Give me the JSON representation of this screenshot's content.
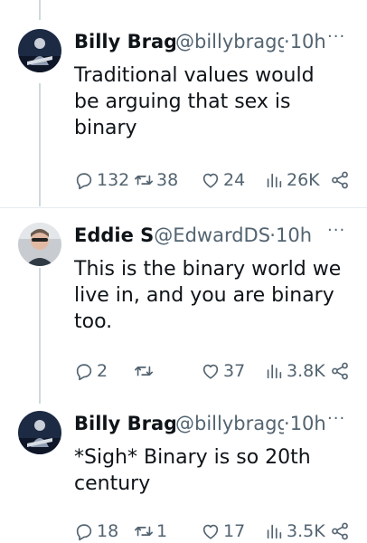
{
  "tweets": [
    {
      "name": "Billy Brag",
      "handle": "@billybragg",
      "dot": "·",
      "time": "10h",
      "text": "Traditional values would be arguing that sex is binary",
      "replies": "132",
      "retweets": "38",
      "likes": "24",
      "views": "26K"
    },
    {
      "name": "Eddie S",
      "handle": "@EdwardDS",
      "dot": "·",
      "time": "10h",
      "text": "This is the binary world we live in, and you are binary too.",
      "replies": "2",
      "retweets": "",
      "likes": "37",
      "views": "3.8K"
    },
    {
      "name": "Billy Brag",
      "handle": "@billybragg",
      "dot": "·",
      "time": "10h",
      "text": "*Sigh* Binary is so 20th century",
      "replies": "18",
      "retweets": "1",
      "likes": "17",
      "views": "3.5K"
    }
  ],
  "icons": {
    "more": "more-icon",
    "reply": "reply-icon",
    "retweet": "retweet-icon",
    "like": "heart-icon",
    "views": "views-icon",
    "share": "share-icon"
  },
  "colors": {
    "text": "#0f1419",
    "secondary": "#536471",
    "thread_line": "#cfd9de"
  }
}
